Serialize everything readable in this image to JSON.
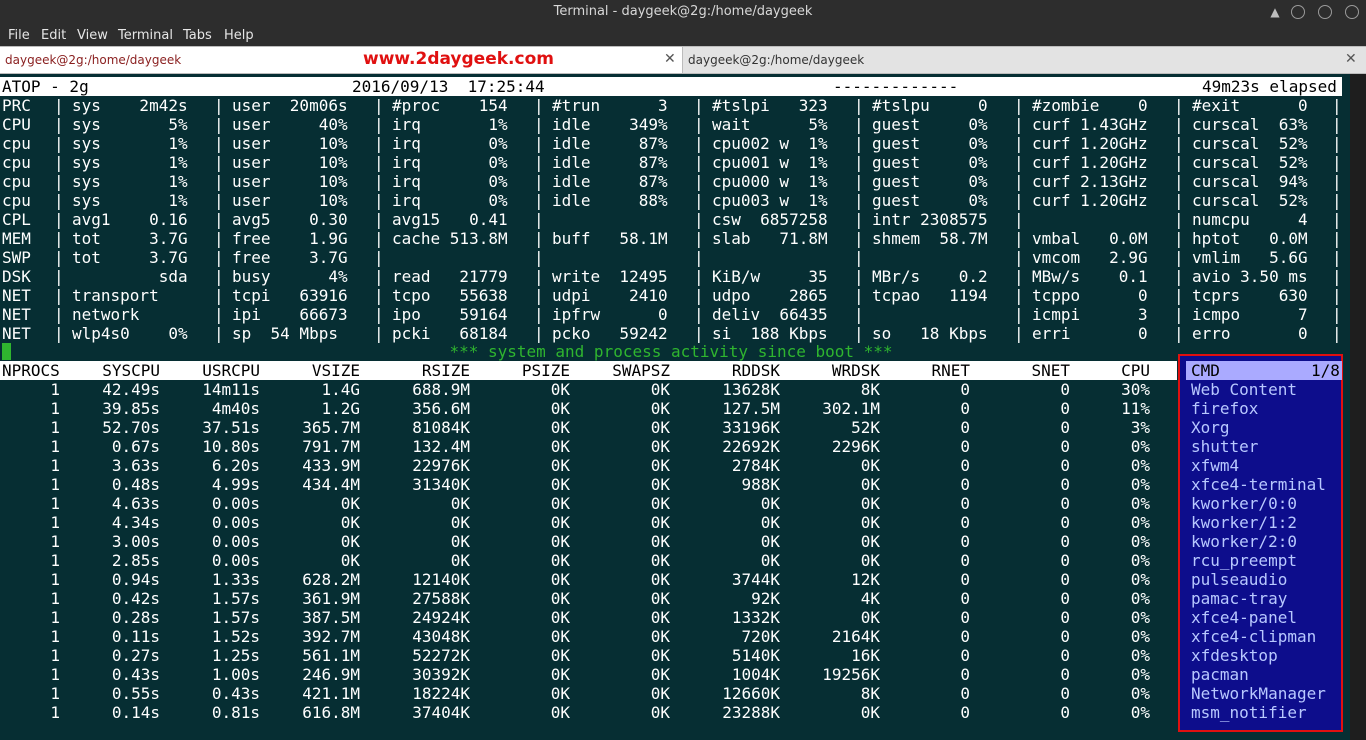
{
  "window": {
    "title": "Terminal - daygeek@2g:/home/daygeek"
  },
  "menu": [
    "File",
    "Edit",
    "View",
    "Terminal",
    "Tabs",
    "Help"
  ],
  "tabs": [
    {
      "label": "daygeek@2g:/home/daygeek",
      "active": true
    },
    {
      "label": "daygeek@2g:/home/daygeek",
      "active": false
    }
  ],
  "watermark": "www.2daygeek.com",
  "header": {
    "left": "ATOP - 2g",
    "datetime": "2016/09/13  17:25:44",
    "dashes": "-------------",
    "elapsed": "49m23s elapsed"
  },
  "system_rows": [
    [
      "PRC",
      "sys    2m42s",
      "user  20m06s",
      "#proc    154",
      "#trun      3",
      "#tslpi   323",
      "#tslpu     0",
      "#zombie    0",
      "#exit      0"
    ],
    [
      "CPU",
      "sys       5%",
      "user     40%",
      "irq       1%",
      "idle    349%",
      "wait      5%",
      "guest     0%",
      "curf 1.43GHz",
      "curscal  63%"
    ],
    [
      "cpu",
      "sys       1%",
      "user     10%",
      "irq       0%",
      "idle     87%",
      "cpu002 w  1%",
      "guest     0%",
      "curf 1.20GHz",
      "curscal  52%"
    ],
    [
      "cpu",
      "sys       1%",
      "user     10%",
      "irq       0%",
      "idle     87%",
      "cpu001 w  1%",
      "guest     0%",
      "curf 1.20GHz",
      "curscal  52%"
    ],
    [
      "cpu",
      "sys       1%",
      "user     10%",
      "irq       0%",
      "idle     87%",
      "cpu000 w  1%",
      "guest     0%",
      "curf 2.13GHz",
      "curscal  94%"
    ],
    [
      "cpu",
      "sys       1%",
      "user     10%",
      "irq       0%",
      "idle     88%",
      "cpu003 w  1%",
      "guest     0%",
      "curf 1.20GHz",
      "curscal  52%"
    ],
    [
      "CPL",
      "avg1    0.16",
      "avg5    0.30",
      "avg15   0.41",
      "",
      "csw  6857258",
      "intr 2308575",
      "",
      "numcpu     4"
    ],
    [
      "MEM",
      "tot     3.7G",
      "free    1.9G",
      "cache 513.8M",
      "buff   58.1M",
      "slab   71.8M",
      "shmem  58.7M",
      "vmbal   0.0M",
      "hptot   0.0M"
    ],
    [
      "SWP",
      "tot     3.7G",
      "free    3.7G",
      "",
      "",
      "",
      "",
      "vmcom   2.9G",
      "vmlim   5.6G"
    ],
    [
      "DSK",
      "         sda",
      "busy      4%",
      "read   21779",
      "write  12495",
      "KiB/w     35",
      "MBr/s    0.2",
      "MBw/s    0.1",
      "avio 3.50 ms"
    ],
    [
      "NET",
      "transport   ",
      "tcpi   63916",
      "tcpo   55638",
      "udpi    2410",
      "udpo    2865",
      "tcpao   1194",
      "tcppo      0",
      "tcprs    630"
    ],
    [
      "NET",
      "network     ",
      "ipi    66673",
      "ipo    59164",
      "ipfrw      0",
      "deliv  66435",
      "",
      "icmpi      3",
      "icmpo      7"
    ],
    [
      "NET",
      "wlp4s0    0%",
      "sp  54 Mbps",
      "pcki   68184",
      "pcko   59242",
      "si  188 Kbps",
      "so   18 Kbps",
      "erri       0",
      "erro       0"
    ]
  ],
  "activity_banner": "*** system and process activity since boot ***",
  "proc_columns": [
    "NPROCS",
    "SYSCPU",
    "USRCPU",
    "VSIZE",
    "RSIZE",
    "PSIZE",
    "SWAPSZ",
    "RDDSK",
    "WRDSK",
    "RNET",
    "SNET",
    "CPU",
    "CMD",
    "1/8"
  ],
  "processes": [
    [
      "1",
      "42.49s",
      "14m11s",
      "1.4G",
      "688.9M",
      "0K",
      "0K",
      "13628K",
      "8K",
      "0",
      "0",
      "30%",
      "Web Content"
    ],
    [
      "1",
      "39.85s",
      "4m40s",
      "1.2G",
      "356.6M",
      "0K",
      "0K",
      "127.5M",
      "302.1M",
      "0",
      "0",
      "11%",
      "firefox"
    ],
    [
      "1",
      "52.70s",
      "37.51s",
      "365.7M",
      "81084K",
      "0K",
      "0K",
      "33196K",
      "52K",
      "0",
      "0",
      "3%",
      "Xorg"
    ],
    [
      "1",
      "0.67s",
      "10.80s",
      "791.7M",
      "132.4M",
      "0K",
      "0K",
      "22692K",
      "2296K",
      "0",
      "0",
      "0%",
      "shutter"
    ],
    [
      "1",
      "3.63s",
      "6.20s",
      "433.9M",
      "22976K",
      "0K",
      "0K",
      "2784K",
      "0K",
      "0",
      "0",
      "0%",
      "xfwm4"
    ],
    [
      "1",
      "0.48s",
      "4.99s",
      "434.4M",
      "31340K",
      "0K",
      "0K",
      "988K",
      "0K",
      "0",
      "0",
      "0%",
      "xfce4-terminal"
    ],
    [
      "1",
      "4.63s",
      "0.00s",
      "0K",
      "0K",
      "0K",
      "0K",
      "0K",
      "0K",
      "0",
      "0",
      "0%",
      "kworker/0:0"
    ],
    [
      "1",
      "4.34s",
      "0.00s",
      "0K",
      "0K",
      "0K",
      "0K",
      "0K",
      "0K",
      "0",
      "0",
      "0%",
      "kworker/1:2"
    ],
    [
      "1",
      "3.00s",
      "0.00s",
      "0K",
      "0K",
      "0K",
      "0K",
      "0K",
      "0K",
      "0",
      "0",
      "0%",
      "kworker/2:0"
    ],
    [
      "1",
      "2.85s",
      "0.00s",
      "0K",
      "0K",
      "0K",
      "0K",
      "0K",
      "0K",
      "0",
      "0",
      "0%",
      "rcu_preempt"
    ],
    [
      "1",
      "0.94s",
      "1.33s",
      "628.2M",
      "12140K",
      "0K",
      "0K",
      "3744K",
      "12K",
      "0",
      "0",
      "0%",
      "pulseaudio"
    ],
    [
      "1",
      "0.42s",
      "1.57s",
      "361.9M",
      "27588K",
      "0K",
      "0K",
      "92K",
      "4K",
      "0",
      "0",
      "0%",
      "pamac-tray"
    ],
    [
      "1",
      "0.28s",
      "1.57s",
      "387.5M",
      "24924K",
      "0K",
      "0K",
      "1332K",
      "0K",
      "0",
      "0",
      "0%",
      "xfce4-panel"
    ],
    [
      "1",
      "0.11s",
      "1.52s",
      "392.7M",
      "43048K",
      "0K",
      "0K",
      "720K",
      "2164K",
      "0",
      "0",
      "0%",
      "xfce4-clipman"
    ],
    [
      "1",
      "0.27s",
      "1.25s",
      "561.1M",
      "52272K",
      "0K",
      "0K",
      "5140K",
      "16K",
      "0",
      "0",
      "0%",
      "xfdesktop"
    ],
    [
      "1",
      "0.43s",
      "1.00s",
      "246.9M",
      "30392K",
      "0K",
      "0K",
      "1004K",
      "19256K",
      "0",
      "0",
      "0%",
      "pacman"
    ],
    [
      "1",
      "0.55s",
      "0.43s",
      "421.1M",
      "18224K",
      "0K",
      "0K",
      "12660K",
      "8K",
      "0",
      "0",
      "0%",
      "NetworkManager"
    ],
    [
      "1",
      "0.14s",
      "0.81s",
      "616.8M",
      "37404K",
      "0K",
      "0K",
      "23288K",
      "0K",
      "0",
      "0",
      "0%",
      "msm_notifier"
    ]
  ]
}
